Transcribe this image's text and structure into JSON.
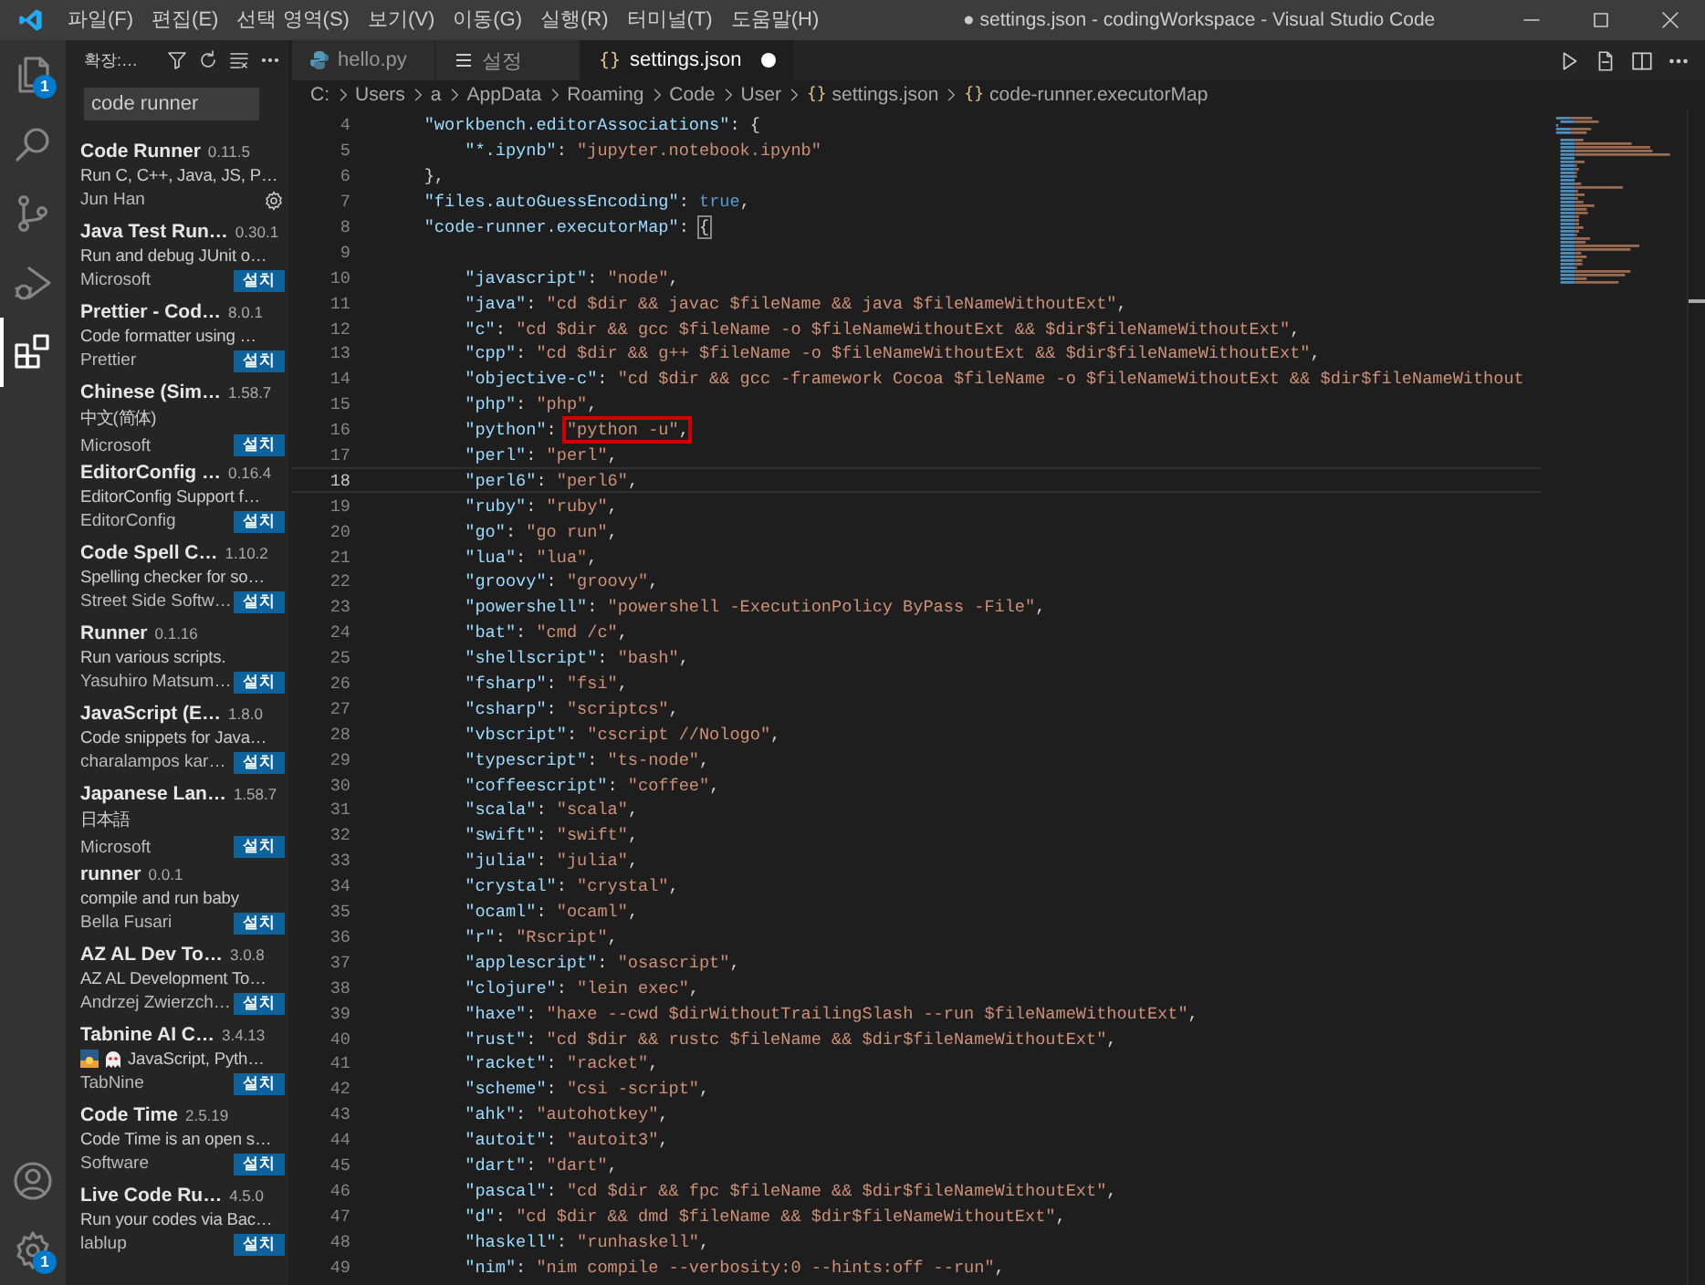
{
  "window": {
    "title": "● settings.json - codingWorkspace - Visual Studio Code"
  },
  "menu": [
    "파일(F)",
    "편집(E)",
    "선택 영역(S)",
    "보기(V)",
    "이동(G)",
    "실행(R)",
    "터미널(T)",
    "도움말(H)"
  ],
  "activity_bar": {
    "top": [
      {
        "kind": "explorer",
        "selected": false,
        "badge": "1"
      },
      {
        "kind": "search",
        "selected": false
      },
      {
        "kind": "source-control",
        "selected": false
      },
      {
        "kind": "run-debug",
        "selected": false
      },
      {
        "kind": "extensions",
        "selected": true
      }
    ],
    "bottom": [
      {
        "kind": "account"
      },
      {
        "kind": "manage",
        "badge": "1"
      }
    ]
  },
  "sidebar": {
    "title": "확장:…",
    "search": {
      "value": "code runner"
    },
    "extensions": [
      {
        "name": "Code Runner",
        "version": "0.11.5",
        "description": "Run C, C++, Java, JS, P…",
        "publisher": "Jun Han",
        "kind": "installed",
        "lead_icons": false
      },
      {
        "name": "Java Test Run…",
        "version": "0.30.1",
        "description": "Run and debug JUnit o…",
        "publisher": "Microsoft",
        "kind": "install",
        "action": "설치",
        "lead_icons": false
      },
      {
        "name": "Prettier - Cod…",
        "version": "8.0.1",
        "description": "Code formatter using …",
        "publisher": "Prettier",
        "kind": "install",
        "action": "설치",
        "lead_icons": false
      },
      {
        "name": "Chinese (Sim…",
        "version": "1.58.7",
        "description": "中文(简体)",
        "publisher": "Microsoft",
        "kind": "install",
        "action": "설치",
        "lead_icons": false
      },
      {
        "name": "EditorConfig …",
        "version": "0.16.4",
        "description": "EditorConfig Support f…",
        "publisher": "EditorConfig",
        "kind": "install",
        "action": "설치",
        "lead_icons": false
      },
      {
        "name": "Code Spell C…",
        "version": "1.10.2",
        "description": "Spelling checker for so…",
        "publisher": "Street Side Softw…",
        "kind": "install",
        "action": "설치",
        "lead_icons": false
      },
      {
        "name": "Runner",
        "version": "0.1.16",
        "description": "Run various scripts.",
        "publisher": "Yasuhiro Matsum…",
        "kind": "install",
        "action": "설치",
        "lead_icons": false
      },
      {
        "name": "JavaScript (E…",
        "version": "1.8.0",
        "description": "Code snippets for Java…",
        "publisher": "charalampos kar…",
        "kind": "install",
        "action": "설치",
        "lead_icons": false
      },
      {
        "name": "Japanese Lan…",
        "version": "1.58.7",
        "description": "日本語",
        "publisher": "Microsoft",
        "kind": "install",
        "action": "설치",
        "lead_icons": false
      },
      {
        "name": "runner",
        "version": "0.0.1",
        "description": "compile and run baby",
        "publisher": "Bella Fusari",
        "kind": "install",
        "action": "설치",
        "lead_icons": false
      },
      {
        "name": "AZ AL Dev To…",
        "version": "3.0.8",
        "description": "AZ AL Development To…",
        "publisher": "Andrzej Zwierzch…",
        "kind": "install",
        "action": "설치",
        "lead_icons": false
      },
      {
        "name": "Tabnine AI C…",
        "version": "3.4.13",
        "description": "JavaScript, Pyth…",
        "publisher": "TabNine",
        "kind": "install",
        "action": "설치",
        "lead_icons": true
      },
      {
        "name": "Code Time",
        "version": "2.5.19",
        "description": "Code Time is an open s…",
        "publisher": "Software",
        "kind": "install",
        "action": "설치",
        "lead_icons": false
      },
      {
        "name": "Live Code Ru…",
        "version": "4.5.0",
        "description": "Run your codes via Bac…",
        "publisher": "lablup",
        "kind": "install",
        "action": "설치",
        "lead_icons": false
      }
    ]
  },
  "tabs": [
    {
      "label": "hello.py",
      "kind": "python",
      "selected": false,
      "modified": false
    },
    {
      "label": "설정",
      "kind": "settings",
      "selected": false,
      "modified": false
    },
    {
      "label": "settings.json",
      "kind": "json",
      "glyph": "{}",
      "selected": true,
      "modified": true
    }
  ],
  "breadcrumb": [
    {
      "text": "C:"
    },
    {
      "text": "Users"
    },
    {
      "text": "a"
    },
    {
      "text": "AppData"
    },
    {
      "text": "Roaming"
    },
    {
      "text": "Code"
    },
    {
      "text": "User"
    },
    {
      "glyph": "{}",
      "text": "settings.json"
    },
    {
      "glyph": "{}",
      "text": "code-runner.executorMap"
    }
  ],
  "editor": {
    "lines": [
      {
        "no": "4",
        "kind": "plain",
        "text": "    \"workbench.editorAssociations\": {"
      },
      {
        "no": "5",
        "kind": "plain",
        "text": "        \"*.ipynb\": \"jupyter.notebook.ipynb\""
      },
      {
        "no": "6",
        "kind": "plain",
        "text": "    },"
      },
      {
        "no": "7",
        "kind": "plain",
        "text": "    \"files.autoGuessEncoding\": true,"
      },
      {
        "no": "8",
        "kind": "bracket-match",
        "text": "    \"code-runner.executorMap\": {"
      },
      {
        "no": "9",
        "kind": "plain"
      },
      {
        "no": "10",
        "kind": "plain",
        "text": "        \"javascript\": \"node\","
      },
      {
        "no": "11",
        "kind": "plain",
        "text": "        \"java\": \"cd $dir && javac $fileName && java $fileNameWithoutExt\","
      },
      {
        "no": "12",
        "kind": "plain",
        "text": "        \"c\": \"cd $dir && gcc $fileName -o $fileNameWithoutExt && $dir$fileNameWithoutExt\","
      },
      {
        "no": "13",
        "kind": "plain",
        "text": "        \"cpp\": \"cd $dir && g++ $fileName -o $fileNameWithoutExt && $dir$fileNameWithoutExt\","
      },
      {
        "no": "14",
        "kind": "plain",
        "text": "        \"objective-c\": \"cd $dir && gcc -framework Cocoa $fileName -o $fileNameWithoutExt && $dir$fileNameWithout"
      },
      {
        "no": "15",
        "kind": "plain",
        "text": "        \"php\": \"php\","
      },
      {
        "no": "16",
        "kind": "boxed",
        "text": "        \"python\": \"python -u\","
      },
      {
        "no": "17",
        "kind": "plain",
        "text": "        \"perl\": \"perl\","
      },
      {
        "no": "18",
        "kind": "current",
        "text": "        \"perl6\": \"perl6\","
      },
      {
        "no": "19",
        "kind": "plain",
        "text": "        \"ruby\": \"ruby\","
      },
      {
        "no": "20",
        "kind": "plain",
        "text": "        \"go\": \"go run\","
      },
      {
        "no": "21",
        "kind": "plain",
        "text": "        \"lua\": \"lua\","
      },
      {
        "no": "22",
        "kind": "plain",
        "text": "        \"groovy\": \"groovy\","
      },
      {
        "no": "23",
        "kind": "plain",
        "text": "        \"powershell\": \"powershell -ExecutionPolicy ByPass -File\","
      },
      {
        "no": "24",
        "kind": "plain",
        "text": "        \"bat\": \"cmd /c\","
      },
      {
        "no": "25",
        "kind": "plain",
        "text": "        \"shellscript\": \"bash\","
      },
      {
        "no": "26",
        "kind": "plain",
        "text": "        \"fsharp\": \"fsi\","
      },
      {
        "no": "27",
        "kind": "plain",
        "text": "        \"csharp\": \"scriptcs\","
      },
      {
        "no": "28",
        "kind": "plain",
        "text": "        \"vbscript\": \"cscript //Nologo\","
      },
      {
        "no": "29",
        "kind": "plain",
        "text": "        \"typescript\": \"ts-node\","
      },
      {
        "no": "30",
        "kind": "plain",
        "text": "        \"coffeescript\": \"coffee\","
      },
      {
        "no": "31",
        "kind": "plain",
        "text": "        \"scala\": \"scala\","
      },
      {
        "no": "32",
        "kind": "plain",
        "text": "        \"swift\": \"swift\","
      },
      {
        "no": "33",
        "kind": "plain",
        "text": "        \"julia\": \"julia\","
      },
      {
        "no": "34",
        "kind": "plain",
        "text": "        \"crystal\": \"crystal\","
      },
      {
        "no": "35",
        "kind": "plain",
        "text": "        \"ocaml\": \"ocaml\","
      },
      {
        "no": "36",
        "kind": "plain",
        "text": "        \"r\": \"Rscript\","
      },
      {
        "no": "37",
        "kind": "plain",
        "text": "        \"applescript\": \"osascript\","
      },
      {
        "no": "38",
        "kind": "plain",
        "text": "        \"clojure\": \"lein exec\","
      },
      {
        "no": "39",
        "kind": "plain",
        "text": "        \"haxe\": \"haxe --cwd $dirWithoutTrailingSlash --run $fileNameWithoutExt\","
      },
      {
        "no": "40",
        "kind": "plain",
        "text": "        \"rust\": \"cd $dir && rustc $fileName && $dir$fileNameWithoutExt\","
      },
      {
        "no": "41",
        "kind": "plain",
        "text": "        \"racket\": \"racket\","
      },
      {
        "no": "42",
        "kind": "plain",
        "text": "        \"scheme\": \"csi -script\","
      },
      {
        "no": "43",
        "kind": "plain",
        "text": "        \"ahk\": \"autohotkey\","
      },
      {
        "no": "44",
        "kind": "plain",
        "text": "        \"autoit\": \"autoit3\","
      },
      {
        "no": "45",
        "kind": "plain",
        "text": "        \"dart\": \"dart\","
      },
      {
        "no": "46",
        "kind": "plain",
        "text": "        \"pascal\": \"cd $dir && fpc $fileName && $dir$fileNameWithoutExt\","
      },
      {
        "no": "47",
        "kind": "plain",
        "text": "        \"d\": \"cd $dir && dmd $fileName && $dir$fileNameWithoutExt\","
      },
      {
        "no": "48",
        "kind": "plain",
        "text": "        \"haskell\": \"runhaskell\","
      },
      {
        "no": "49",
        "kind": "plain",
        "text": "        \"nim\": \"nim compile --verbosity:0 --hints:off --run\","
      }
    ]
  }
}
